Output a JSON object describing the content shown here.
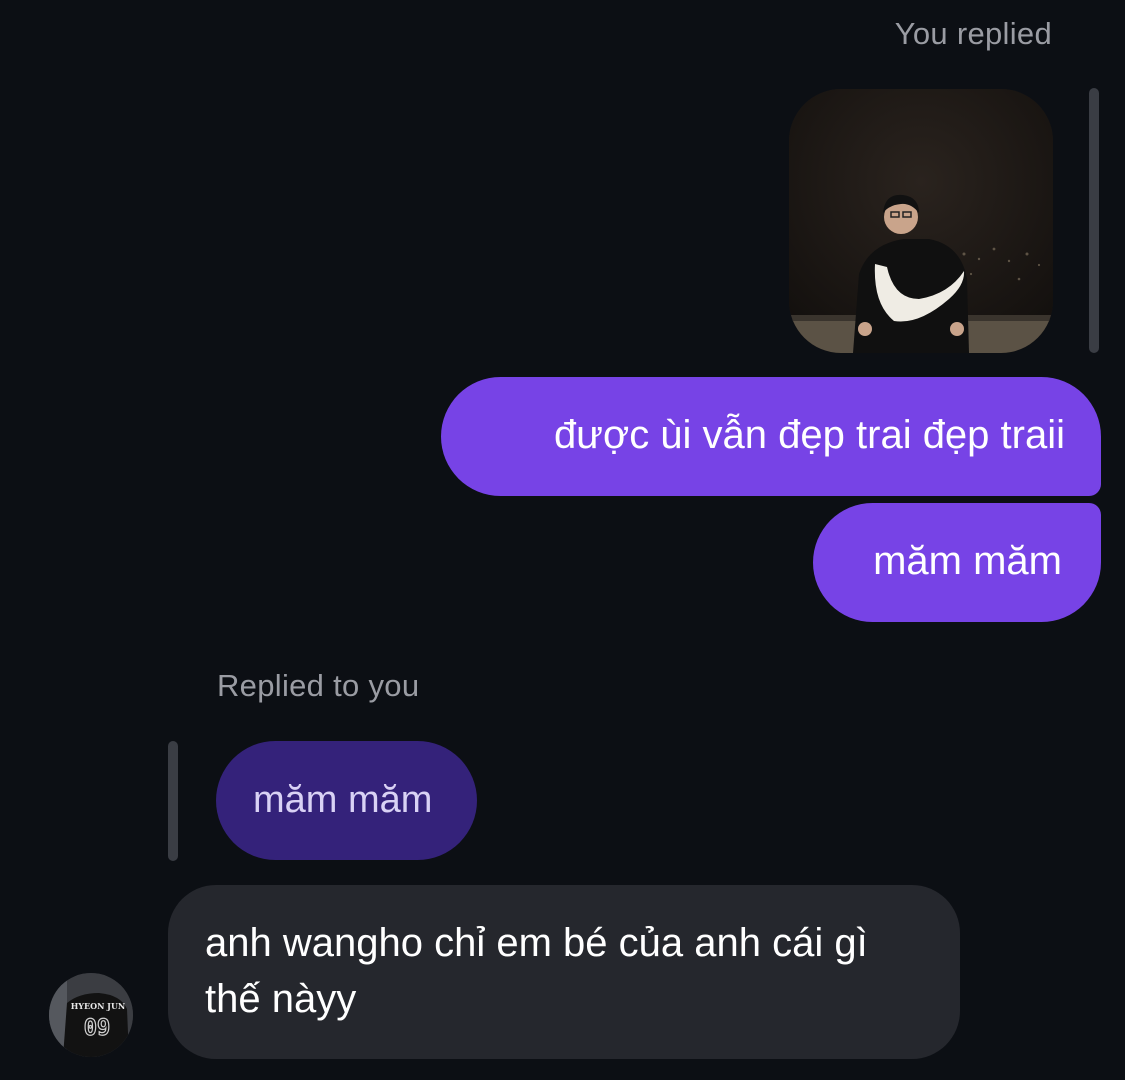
{
  "thread": {
    "you_replied_label": "You replied",
    "replied_to_you_label": "Replied to you"
  },
  "outgoing": {
    "photo_alt": "Photo of a person in a black and white jacket at night",
    "messages": [
      "được ùi vẫn đẹp trai đẹp traii",
      "măm măm"
    ]
  },
  "incoming": {
    "quoted_message": "măm măm",
    "message": "anh wangho chỉ em bé của anh cái gì thế nàyy",
    "avatar_text": "HYEON JUN",
    "avatar_number": "09"
  },
  "colors": {
    "background": "#0c0f14",
    "outgoing_bubble": "#7743e6",
    "quoted_bubble": "#34227a",
    "incoming_bubble": "#25272d",
    "meta_text": "#9a9ca3"
  }
}
